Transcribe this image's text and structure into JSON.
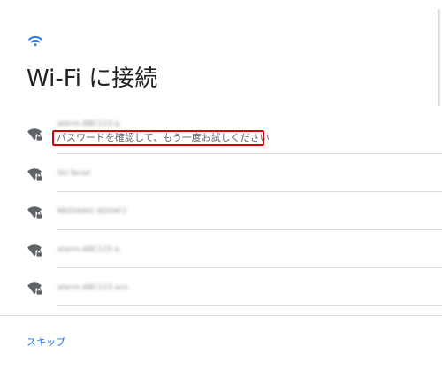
{
  "header": {
    "icon": "wifi-icon",
    "title": "Wi-Fi に接続"
  },
  "networks": [
    {
      "ssid": "aterm-ABC123-g",
      "secured": true,
      "icon": "wifi-lock-icon",
      "status": "パスワードを確認して、もう一度お試しください"
    },
    {
      "ssid": "SG-Tenet",
      "secured": true,
      "icon": "wifi-lock-icon"
    },
    {
      "ssid": "MEDIANIC-8D5AF2",
      "secured": true,
      "icon": "wifi-lock-icon"
    },
    {
      "ssid": "aterm-ABC125-a",
      "secured": true,
      "icon": "wifi-lock-icon"
    },
    {
      "ssid": "aterm-ABC123-ans",
      "secured": true,
      "icon": "wifi-lock-icon"
    }
  ],
  "footer": {
    "skip_label": "スキップ"
  },
  "colors": {
    "accent": "#1a73e8",
    "error_outline": "#e00000",
    "icon": "#5f6368",
    "divider": "#dcdcdc"
  }
}
